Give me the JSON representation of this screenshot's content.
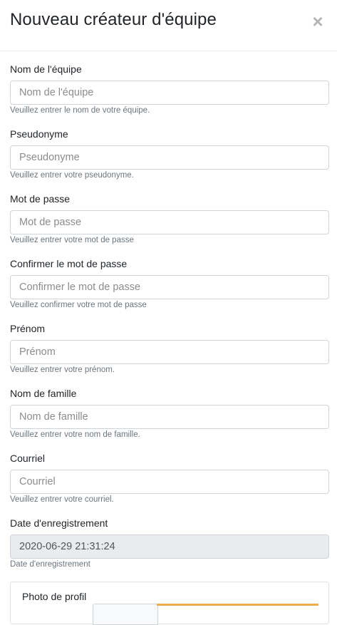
{
  "modal": {
    "title": "Nouveau créateur d'équipe",
    "close_symbol": "×"
  },
  "fields": [
    {
      "label": "Nom de l'équipe",
      "placeholder": "Nom de l'équipe",
      "value": "",
      "help": "Veuillez entrer le nom de votre équipe."
    },
    {
      "label": "Pseudonyme",
      "placeholder": "Pseudonyme",
      "value": "",
      "help": "Veuillez entrer votre pseudonyme."
    },
    {
      "label": "Mot de passe",
      "placeholder": "Mot de passe",
      "value": "",
      "help": "Veuillez entrer votre mot de passe"
    },
    {
      "label": "Confirmer le mot de passe",
      "placeholder": "Confirmer le mot de passe",
      "value": "",
      "help": "Veuillez confirmer votre mot de passe"
    },
    {
      "label": "Prénom",
      "placeholder": "Prénom",
      "value": "",
      "help": "Veuillez entrer votre prénom."
    },
    {
      "label": "Nom de famille",
      "placeholder": "Nom de famille",
      "value": "",
      "help": "Veuillez entrer votre nom de famille."
    },
    {
      "label": "Courriel",
      "placeholder": "Courriel",
      "value": "",
      "help": "Veuillez entrer votre courriel."
    },
    {
      "label": "Date d'enregistrement",
      "placeholder": "",
      "value": "2020-06-29 21:31:24",
      "help": "Date d'enregistrement"
    }
  ],
  "photo": {
    "label": "Photo de profil"
  },
  "colors": {
    "border": "#ced4da",
    "readonly_bg": "#e9ecef",
    "upload_accent": "#f0ad4e"
  }
}
